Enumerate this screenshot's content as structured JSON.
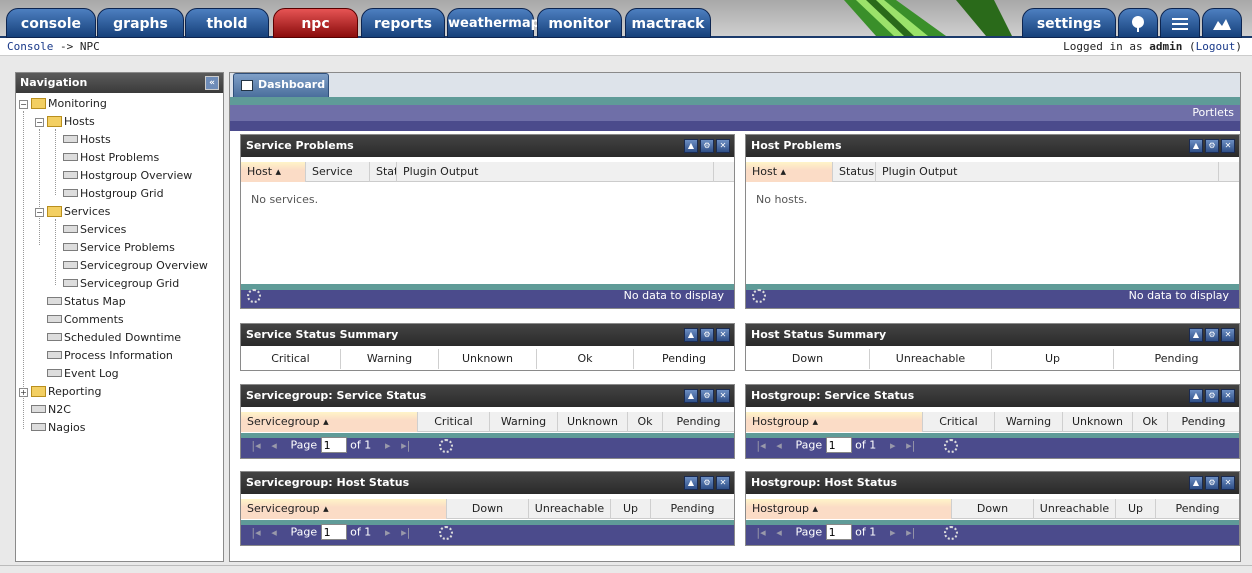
{
  "top_tabs": [
    {
      "label": "console"
    },
    {
      "label": "graphs"
    },
    {
      "label": "thold"
    },
    {
      "label": "npc"
    },
    {
      "label": "reports"
    },
    {
      "label": "weathermap"
    },
    {
      "label": "monitor"
    },
    {
      "label": "mactrack"
    }
  ],
  "settings_label": "settings",
  "right_icons": [
    "tree-icon",
    "list-icon",
    "graph-icon"
  ],
  "breadcrumb": {
    "home": "Console",
    "sep": "->",
    "current": "NPC"
  },
  "login": {
    "prefix": "Logged in as",
    "user": "admin",
    "open": "(",
    "logout": "Logout",
    "close": ")"
  },
  "nav": {
    "title": "Navigation",
    "items": [
      {
        "label": "Monitoring"
      },
      {
        "label": "Hosts"
      },
      {
        "label": "Hosts"
      },
      {
        "label": "Host Problems"
      },
      {
        "label": "Hostgroup Overview"
      },
      {
        "label": "Hostgroup Grid"
      },
      {
        "label": "Services"
      },
      {
        "label": "Services"
      },
      {
        "label": "Service Problems"
      },
      {
        "label": "Servicegroup Overview"
      },
      {
        "label": "Servicegroup Grid"
      },
      {
        "label": "Status Map"
      },
      {
        "label": "Comments"
      },
      {
        "label": "Scheduled Downtime"
      },
      {
        "label": "Process Information"
      },
      {
        "label": "Event Log"
      },
      {
        "label": "Reporting"
      },
      {
        "label": "N2C"
      },
      {
        "label": "Nagios"
      }
    ]
  },
  "main": {
    "tab_label": "Dashboard",
    "portlets_label": "Portlets"
  },
  "service_problems": {
    "title": "Service Problems",
    "cols": [
      "Host",
      "Service",
      "Statu",
      "Plugin Output"
    ],
    "empty": "No services.",
    "footer": "No data to display"
  },
  "host_problems": {
    "title": "Host Problems",
    "cols": [
      "Host",
      "Status",
      "Plugin Output"
    ],
    "empty": "No hosts.",
    "footer": "No data to display"
  },
  "service_status_summary": {
    "title": "Service Status Summary",
    "cols": [
      "Critical",
      "Warning",
      "Unknown",
      "Ok",
      "Pending"
    ]
  },
  "host_status_summary": {
    "title": "Host Status Summary",
    "cols": [
      "Down",
      "Unreachable",
      "Up",
      "Pending"
    ]
  },
  "sg_service_status": {
    "title": "Servicegroup: Service Status",
    "cols": [
      "Servicegroup",
      "Critical",
      "Warning",
      "Unknown",
      "Ok",
      "Pending"
    ]
  },
  "hg_service_status": {
    "title": "Hostgroup: Service Status",
    "cols": [
      "Hostgroup",
      "Critical",
      "Warning",
      "Unknown",
      "Ok",
      "Pending"
    ]
  },
  "sg_host_status": {
    "title": "Servicegroup: Host Status",
    "cols": [
      "Servicegroup",
      "Down",
      "Unreachable",
      "Up",
      "Pending"
    ]
  },
  "hg_host_status": {
    "title": "Hostgroup: Host Status",
    "cols": [
      "Hostgroup",
      "Down",
      "Unreachable",
      "Up",
      "Pending"
    ]
  },
  "pager": {
    "page_label": "Page",
    "page_value": "1",
    "of_label": "of 1"
  }
}
